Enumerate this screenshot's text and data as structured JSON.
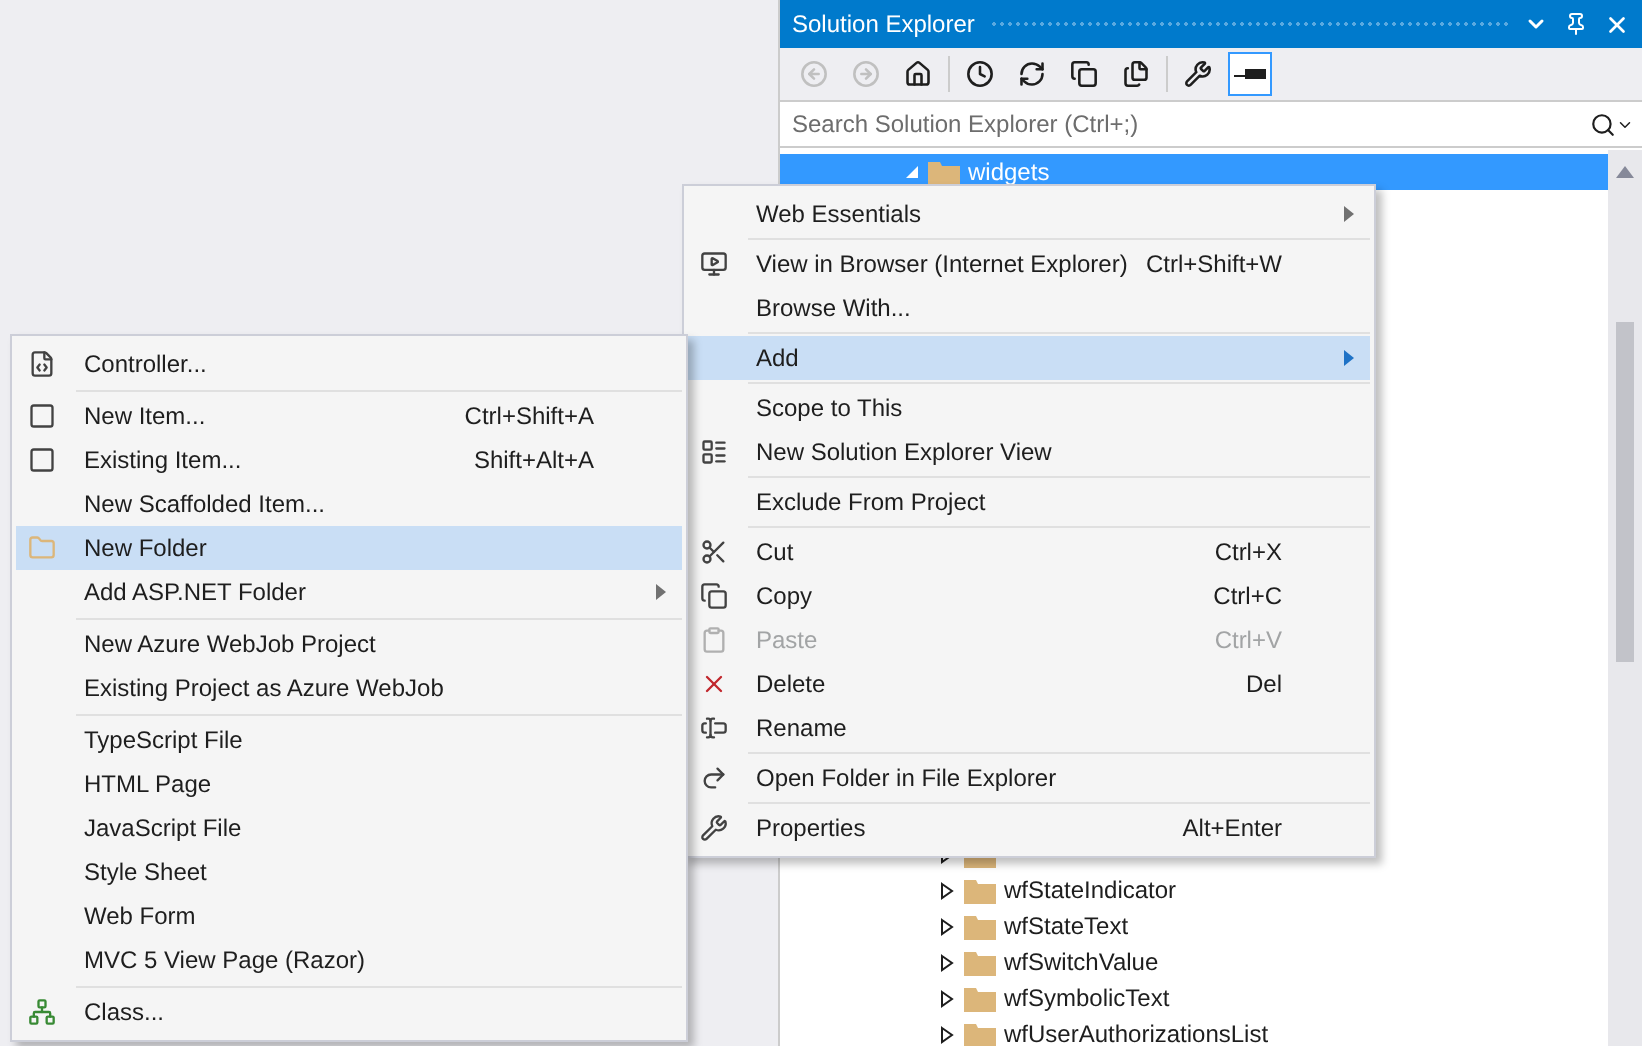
{
  "solution_explorer": {
    "title": "Solution Explorer",
    "toolbar": [
      {
        "disabled": true,
        "selected": false
      },
      {
        "disabled": true,
        "selected": false
      },
      {
        "disabled": false,
        "selected": false
      },
      {
        "disabled": false,
        "selected": false
      },
      {
        "disabled": false,
        "selected": false
      },
      {
        "disabled": false,
        "selected": false
      },
      {
        "disabled": false,
        "selected": false
      },
      {
        "disabled": false,
        "selected": false
      },
      {
        "disabled": false,
        "selected": true
      }
    ],
    "search": {
      "placeholder": "Search Solution Explorer (Ctrl+;)"
    },
    "tree": [
      {
        "label": "widgets",
        "selected": true,
        "expanded": true,
        "children": [
          {
            "selected": false,
            "expanded": false
          },
          {
            "label": "wfStateIndicator",
            "selected": false,
            "expanded": false
          },
          {
            "label": "wfStateText",
            "selected": false,
            "expanded": false
          },
          {
            "label": "wfSwitchValue",
            "selected": false,
            "expanded": false
          },
          {
            "label": "wfSymbolicText",
            "selected": false,
            "expanded": false
          },
          {
            "label": "wfUserAuthorizationsList",
            "selected": false,
            "expanded": false
          }
        ]
      }
    ]
  },
  "context_menu": {
    "groups": [
      [
        {
          "label": "Web Essentials",
          "submenu": true,
          "selected": false,
          "disabled": false
        }
      ],
      [
        {
          "label": "View in Browser (Internet Explorer)",
          "shortcut": "Ctrl+Shift+W",
          "submenu": false,
          "selected": false,
          "disabled": false
        },
        {
          "label": "Browse With...",
          "submenu": false,
          "selected": false,
          "disabled": false
        }
      ],
      [
        {
          "label": "Add",
          "submenu": true,
          "selected": true,
          "disabled": false
        }
      ],
      [
        {
          "label": "Scope to This",
          "submenu": false,
          "selected": false,
          "disabled": false
        },
        {
          "label": "New Solution Explorer View",
          "submenu": false,
          "selected": false,
          "disabled": false
        }
      ],
      [
        {
          "label": "Exclude From Project",
          "submenu": false,
          "selected": false,
          "disabled": false
        }
      ],
      [
        {
          "label": "Cut",
          "shortcut": "Ctrl+X",
          "submenu": false,
          "selected": false,
          "disabled": false
        },
        {
          "label": "Copy",
          "shortcut": "Ctrl+C",
          "submenu": false,
          "selected": false,
          "disabled": false
        },
        {
          "label": "Paste",
          "shortcut": "Ctrl+V",
          "submenu": false,
          "selected": false,
          "disabled": true
        },
        {
          "label": "Delete",
          "shortcut": "Del",
          "submenu": false,
          "selected": false,
          "disabled": false
        },
        {
          "label": "Rename",
          "submenu": false,
          "selected": false,
          "disabled": false
        }
      ],
      [
        {
          "label": "Open Folder in File Explorer",
          "submenu": false,
          "selected": false,
          "disabled": false
        }
      ],
      [
        {
          "label": "Properties",
          "shortcut": "Alt+Enter",
          "submenu": false,
          "selected": false,
          "disabled": false
        }
      ]
    ]
  },
  "add_submenu": {
    "groups": [
      [
        {
          "label": "Controller...",
          "submenu": false,
          "selected": false,
          "disabled": false
        }
      ],
      [
        {
          "label": "New Item...",
          "shortcut": "Ctrl+Shift+A",
          "submenu": false,
          "selected": false,
          "disabled": false
        },
        {
          "label": "Existing Item...",
          "shortcut": "Shift+Alt+A",
          "submenu": false,
          "selected": false,
          "disabled": false
        },
        {
          "label": "New Scaffolded Item...",
          "submenu": false,
          "selected": false,
          "disabled": false
        },
        {
          "label": "New Folder",
          "submenu": false,
          "selected": true,
          "disabled": false
        },
        {
          "label": "Add ASP.NET Folder",
          "submenu": true,
          "selected": false,
          "disabled": false
        }
      ],
      [
        {
          "label": "New Azure WebJob Project",
          "submenu": false,
          "selected": false,
          "disabled": false
        },
        {
          "label": "Existing Project as Azure WebJob",
          "submenu": false,
          "selected": false,
          "disabled": false
        }
      ],
      [
        {
          "label": "TypeScript File",
          "submenu": false,
          "selected": false,
          "disabled": false
        },
        {
          "label": "HTML Page",
          "submenu": false,
          "selected": false,
          "disabled": false
        },
        {
          "label": "JavaScript File",
          "submenu": false,
          "selected": false,
          "disabled": false
        },
        {
          "label": "Style Sheet",
          "submenu": false,
          "selected": false,
          "disabled": false
        },
        {
          "label": "Web Form",
          "submenu": false,
          "selected": false,
          "disabled": false
        },
        {
          "label": "MVC 5 View Page (Razor)",
          "submenu": false,
          "selected": false,
          "disabled": false
        }
      ],
      [
        {
          "label": "Class...",
          "submenu": false,
          "selected": false,
          "disabled": false
        }
      ]
    ]
  }
}
